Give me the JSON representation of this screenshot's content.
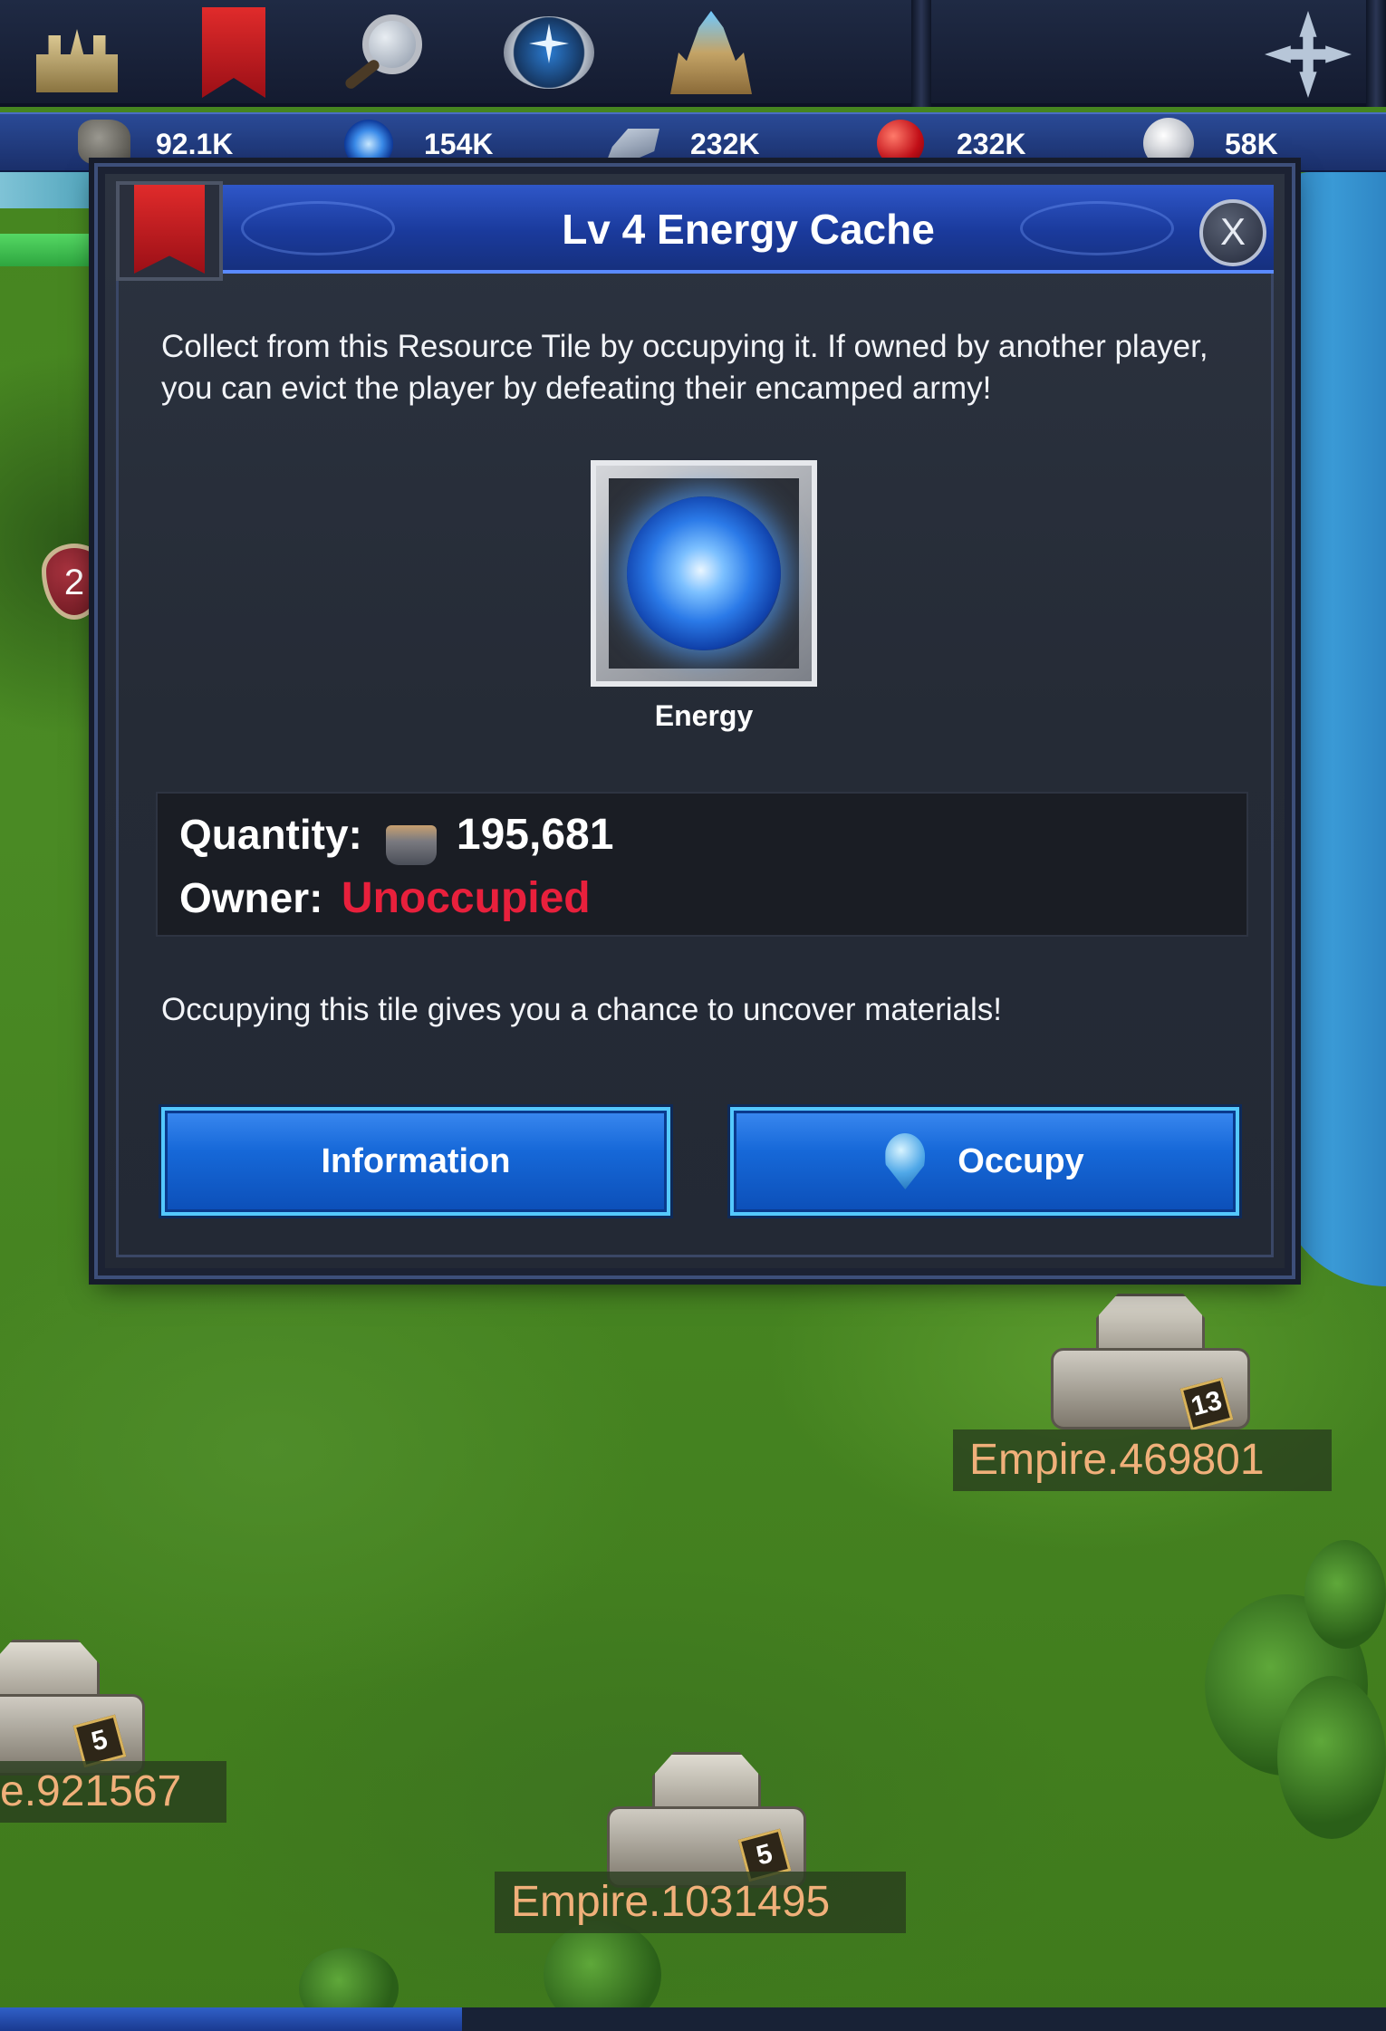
{
  "top_bar": {
    "icons": [
      "castle-icon",
      "bookmark-icon",
      "search-icon",
      "compass-icon",
      "palace-icon",
      "move-arrows-icon"
    ]
  },
  "resources": [
    {
      "icon": "stone-icon",
      "value": "92.1K"
    },
    {
      "icon": "energy-icon",
      "value": "154K"
    },
    {
      "icon": "ore-icon",
      "value": "232K"
    },
    {
      "icon": "food-icon",
      "value": "232K"
    },
    {
      "icon": "silver-icon",
      "value": "58K"
    }
  ],
  "dialog": {
    "title": "Lv 4 Energy Cache",
    "close_label": "X",
    "description": "Collect from this Resource Tile by occupying it. If owned by another player, you can evict the player by defeating their encamped army!",
    "resource_name": "Energy",
    "quantity_label": "Quantity:",
    "quantity_value": "195,681",
    "owner_label": "Owner:",
    "owner_value": "Unoccupied",
    "note": "Occupying this tile gives you a chance to uncover materials!",
    "info_button": "Information",
    "occupy_button": "Occupy"
  },
  "map": {
    "badge": "2",
    "cities": [
      {
        "name": "Empire.469801",
        "level": "13"
      },
      {
        "name": "e.921567",
        "level": "5"
      },
      {
        "name": "Empire.1031495",
        "level": "5"
      }
    ]
  },
  "colors": {
    "owner_unoccupied": "#e8203c",
    "title_bar": "#1a3a9c",
    "button": "#1668d8"
  }
}
